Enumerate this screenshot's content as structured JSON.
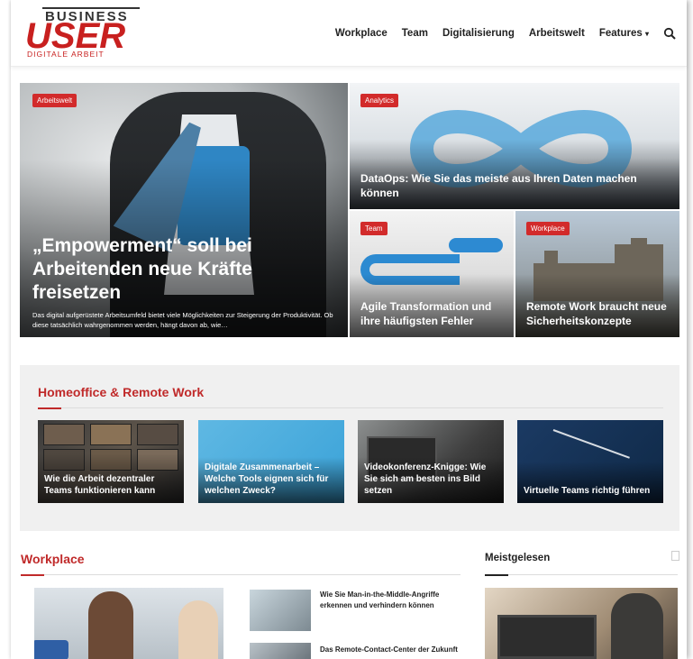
{
  "header": {
    "logo": {
      "top": "BUSINESS",
      "main": "USER",
      "sub": "DIGITALE ARBEIT"
    },
    "nav": [
      "Workplace",
      "Team",
      "Digitalisierung",
      "Arbeitswelt",
      "Features"
    ],
    "features_caret": "▾",
    "search_icon": "search-icon"
  },
  "hero": {
    "main": {
      "tag": "Arbeitswelt",
      "title": "„Empowerment“ soll bei Arbeitenden neue Kräfte freisetzen",
      "excerpt": "Das digital aufgerüstete Arbeitsumfeld bietet viele Möglichkeiten zur Steigerung der Produktivität. Ob diese tatsächlich wahrgenommen werden, hängt davon ab, wie…"
    },
    "tile_a": {
      "tag": "Analytics",
      "title": "DataOps: Wie Sie das meiste aus Ihren Daten machen können"
    },
    "tile_b": {
      "tag": "Team",
      "title": "Agile Transformation und ihre häufigsten Fehler"
    },
    "tile_c": {
      "tag": "Workplace",
      "title": "Remote Work braucht neue Sicherheitskonzepte"
    }
  },
  "homeoffice": {
    "title": "Homeoffice & Remote Work",
    "cards": [
      {
        "title": "Wie die Arbeit dezentraler Teams funktionieren kann"
      },
      {
        "title": "Digitale Zusammenarbeit – Welche Tools eignen sich für welchen Zweck?"
      },
      {
        "title": "Videokonferenz-Knigge: Wie Sie sich am besten ins Bild setzen"
      },
      {
        "title": "Virtuelle Teams richtig führen"
      }
    ]
  },
  "workplace": {
    "title": "Workplace",
    "items": [
      {
        "title": "Wie Sie Man-in-the-Middle-Angriffe erkennen und verhindern können"
      },
      {
        "title": "Das Remote-Contact-Center der Zukunft"
      }
    ]
  },
  "meistgelesen": {
    "title": "Meistgelesen"
  },
  "colors": {
    "brand_red": "#c8201f",
    "tag_red": "#d22b2b"
  }
}
